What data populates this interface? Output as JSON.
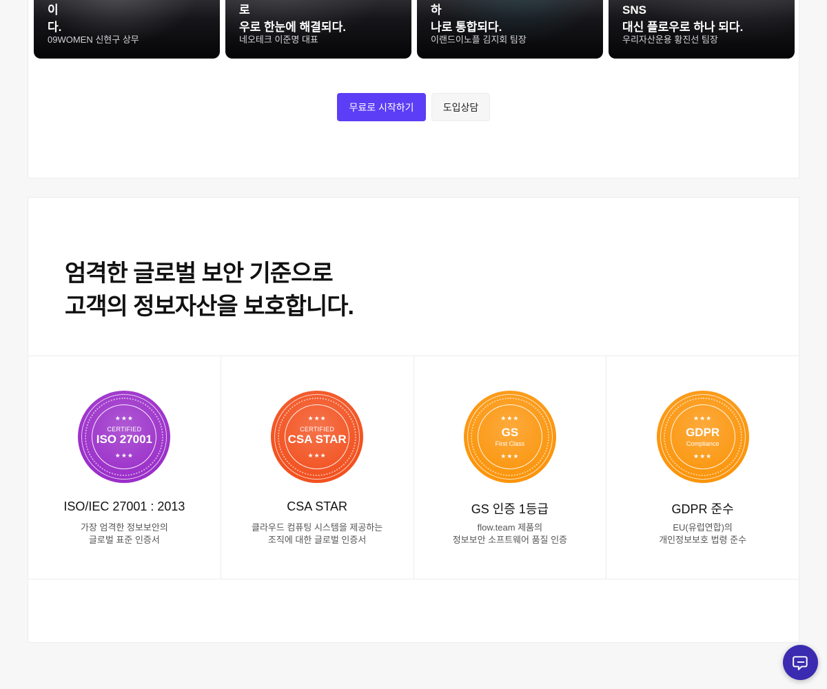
{
  "testimonials": [
    {
      "quote": "흩어진 업무가 플로우 하나로 모이\n다.",
      "author": "09WOMEN 신현구 상무"
    },
    {
      "quote": "제조 현장의 복잡한 업무 관리, 플로\n우로 한눈에 해결되다.",
      "author": "네오테크 이준명 대표"
    },
    {
      "quote": "산립하던 모든 협업 툴이 플로우 하\n나로 통합되다.",
      "author": "이랜드이노플 김지회 팀장"
    },
    {
      "quote": "금융사 담당자들의 업무 소통, SNS\n대신 플로우로 하나 되다.",
      "author": "우리자산운용 황진선 팀장"
    }
  ],
  "cta": {
    "primary_label": "무료로 시작하기",
    "secondary_label": "도입상담"
  },
  "security": {
    "heading": "엄격한 글로벌 보안 기준으로\n고객의 정보자산을 보호합니다.",
    "certs": [
      {
        "badge_top": "CERTIFIED",
        "badge_main": "ISO 27001",
        "badge_sub": "",
        "badge_color": "#9b2fc9",
        "title": "ISO/IEC 27001 : 2013",
        "desc": "가장 엄격한 정보보안의\n글로벌 표준 인증서"
      },
      {
        "badge_top": "CERTIFIED",
        "badge_main": "CSA STAR",
        "badge_sub": "",
        "badge_color": "#f2511f",
        "title": "CSA STAR",
        "desc": "클라우드 컴퓨팅 시스템을 제공하는\n조직에 대한 글로벌 인증서"
      },
      {
        "badge_top": "",
        "badge_main": "GS",
        "badge_sub": "First Class",
        "badge_color": "#fb950c",
        "title": "GS 인증 1등급",
        "desc": "flow.team 제품의\n정보보안 소프트웨어 품질 인증"
      },
      {
        "badge_top": "",
        "badge_main": "GDPR",
        "badge_sub": "Compliance",
        "badge_color": "#fb950c",
        "title": "GDPR 준수",
        "desc": "EU(유럽연합)의\n개인정보보호 법령 준수"
      }
    ]
  },
  "chat": {
    "icon": "chat-bubble-icon",
    "color": "#3a2bb0"
  }
}
